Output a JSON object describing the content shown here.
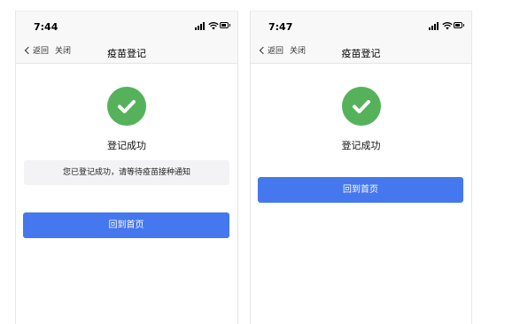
{
  "screens": [
    {
      "status_time": "7:44",
      "nav": {
        "back_label": "返回",
        "close_label": "关闭",
        "title": "疫苗登记"
      },
      "success_title": "登记成功",
      "notice": "您已登记成功，请等待疫苗接种通知",
      "home_button": "回到首页",
      "colors": {
        "success": "#55b25b",
        "button": "#4577ee"
      }
    },
    {
      "status_time": "7:47",
      "nav": {
        "back_label": "返回",
        "close_label": "关闭",
        "title": "疫苗登记"
      },
      "success_title": "登记成功",
      "home_button": "回到首页",
      "colors": {
        "success": "#55b25b",
        "button": "#4577ee"
      }
    }
  ]
}
